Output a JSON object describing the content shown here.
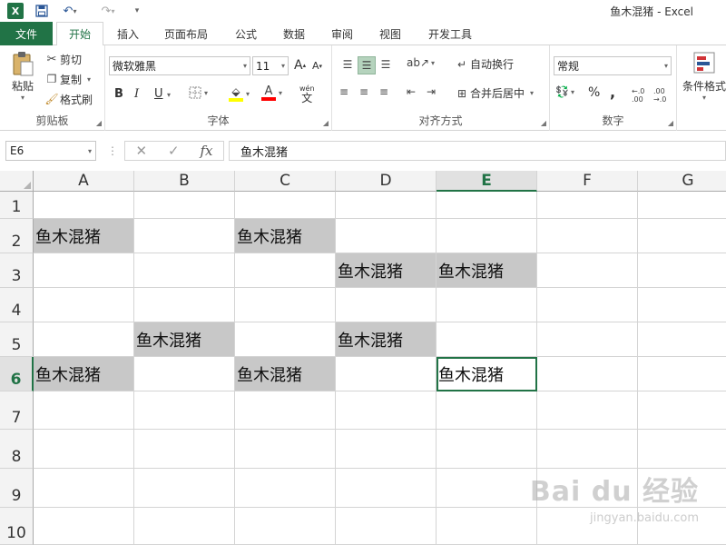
{
  "window": {
    "title": "鱼木混猪 - Excel",
    "app_icon": "X",
    "qat_icons": [
      "save-icon",
      "undo-icon",
      "redo-icon",
      "customize-qat-icon"
    ]
  },
  "tabs": {
    "file": "文件",
    "items": [
      "开始",
      "插入",
      "页面布局",
      "公式",
      "数据",
      "审阅",
      "视图",
      "开发工具"
    ],
    "active": "开始"
  },
  "ribbon": {
    "clipboard": {
      "label": "剪贴板",
      "paste": "粘贴",
      "cut": "剪切",
      "copy": "复制",
      "format_painter": "格式刷"
    },
    "font": {
      "label": "字体",
      "name": "微软雅黑",
      "size": "11",
      "bold": "B",
      "italic": "I",
      "underline": "U",
      "grow": "A",
      "shrink": "A",
      "phonetic": "wén",
      "color_accent": "#ff0000",
      "highlight_accent": "#ffff00"
    },
    "alignment": {
      "label": "对齐方式",
      "wrap_text": "自动换行",
      "merge_center": "合并后居中"
    },
    "number": {
      "label": "数字",
      "format": "常规",
      "percent": "%",
      "comma": ","
    },
    "styles": {
      "conditional_format": "条件格式"
    }
  },
  "formula_bar": {
    "name_box": "E6",
    "fx": "fx",
    "content": "鱼木混猪"
  },
  "grid": {
    "columns": [
      "A",
      "B",
      "C",
      "D",
      "E",
      "F",
      "G"
    ],
    "rows": [
      "1",
      "2",
      "3",
      "4",
      "5",
      "6",
      "7",
      "8",
      "9",
      "10"
    ],
    "selected_column": "E",
    "selected_row": "6",
    "fill_color": "#c8c8c8",
    "cell_text": "鱼木混猪",
    "filled_cells": [
      {
        "col": "A",
        "row": "2",
        "text": "鱼木混猪",
        "fill": true
      },
      {
        "col": "C",
        "row": "2",
        "text": "鱼木混猪",
        "fill": true
      },
      {
        "col": "D",
        "row": "3",
        "text": "鱼木混猪",
        "fill": true
      },
      {
        "col": "E",
        "row": "3",
        "text": "鱼木混猪",
        "fill": true
      },
      {
        "col": "B",
        "row": "5",
        "text": "鱼木混猪",
        "fill": true
      },
      {
        "col": "D",
        "row": "5",
        "text": "鱼木混猪",
        "fill": true
      },
      {
        "col": "A",
        "row": "6",
        "text": "鱼木混猪",
        "fill": true
      },
      {
        "col": "C",
        "row": "6",
        "text": "鱼木混猪",
        "fill": true
      },
      {
        "col": "E",
        "row": "6",
        "text": "鱼木混猪",
        "fill": false,
        "active": true
      }
    ]
  },
  "watermark": {
    "text": "Bai du 经验",
    "sub": "jingyan.baidu.com"
  }
}
